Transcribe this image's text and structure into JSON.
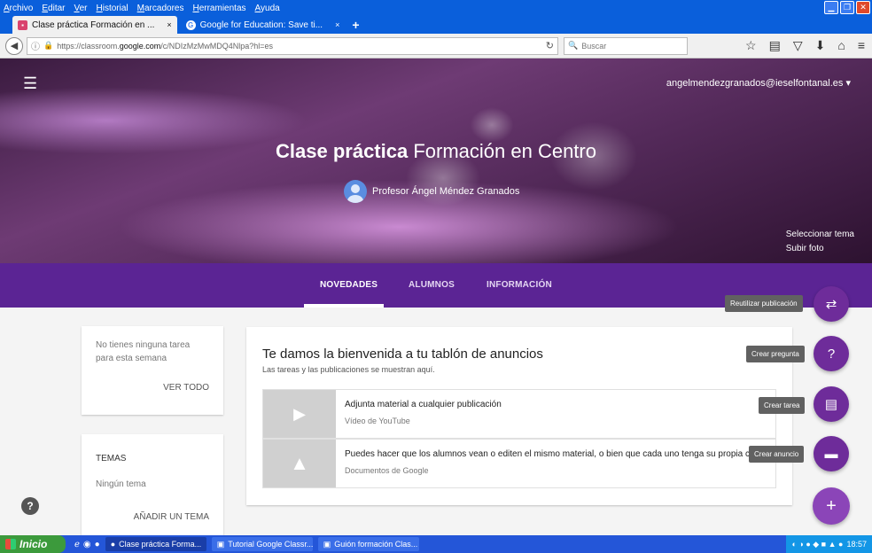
{
  "window": {
    "menu": [
      "Archivo",
      "Editar",
      "Ver",
      "Historial",
      "Marcadores",
      "Herramientas",
      "Ayuda"
    ]
  },
  "tabs": [
    {
      "label": "Clase práctica Formación en ...",
      "close": "×"
    },
    {
      "label": "Google for Education: Save ti...",
      "close": "×"
    }
  ],
  "newtab_label": "+",
  "url": {
    "prefix": "https://classroom.",
    "domain": "google.com",
    "suffix": "/c/NDIzMzMwMDQ4Nlpa?hl=es"
  },
  "search_placeholder": "Buscar",
  "hero": {
    "user": "angelmendezgranados@ieselfontanal.es ▾",
    "title_bold": "Clase práctica",
    "title_rest": " Formación en Centro",
    "teacher": "Profesor Ángel Méndez Granados",
    "select_theme": "Seleccionar tema",
    "upload_photo": "Subir foto"
  },
  "classnav": {
    "tabs": [
      "NOVEDADES",
      "ALUMNOS",
      "INFORMACIÓN"
    ]
  },
  "tasks_card": {
    "text": "No tienes ninguna tarea para esta semana",
    "link": "VER TODO"
  },
  "topics_card": {
    "heading": "TEMAS",
    "empty": "Ningún tema",
    "link": "AÑADIR UN TEMA"
  },
  "welcome": {
    "title": "Te damos la bienvenida a tu tablón de anuncios",
    "subtitle": "Las tareas y las publicaciones se muestran aquí.",
    "items": [
      {
        "title": "Adjunta material a cualquier publicación",
        "source": "Vídeo de YouTube"
      },
      {
        "title": "Puedes hacer que los alumnos vean o editen el mismo material, o bien que cada uno tenga su propia copia",
        "source": "Documentos de Google"
      }
    ]
  },
  "fab_tooltips": {
    "reuse": "Reutilizar publicación",
    "question": "Crear pregunta",
    "assignment": "Crear tarea",
    "announcement": "Crear anuncio"
  },
  "taskbar": {
    "start": "Inicio",
    "tasks": [
      "Clase práctica Forma...",
      "Tutorial Google Classr...",
      "Guión formación Clas..."
    ],
    "clock": "18:57"
  },
  "colors": {
    "accent": "#5b2494",
    "fab": "#6e2c9a",
    "taskbar": "#2456d8"
  }
}
